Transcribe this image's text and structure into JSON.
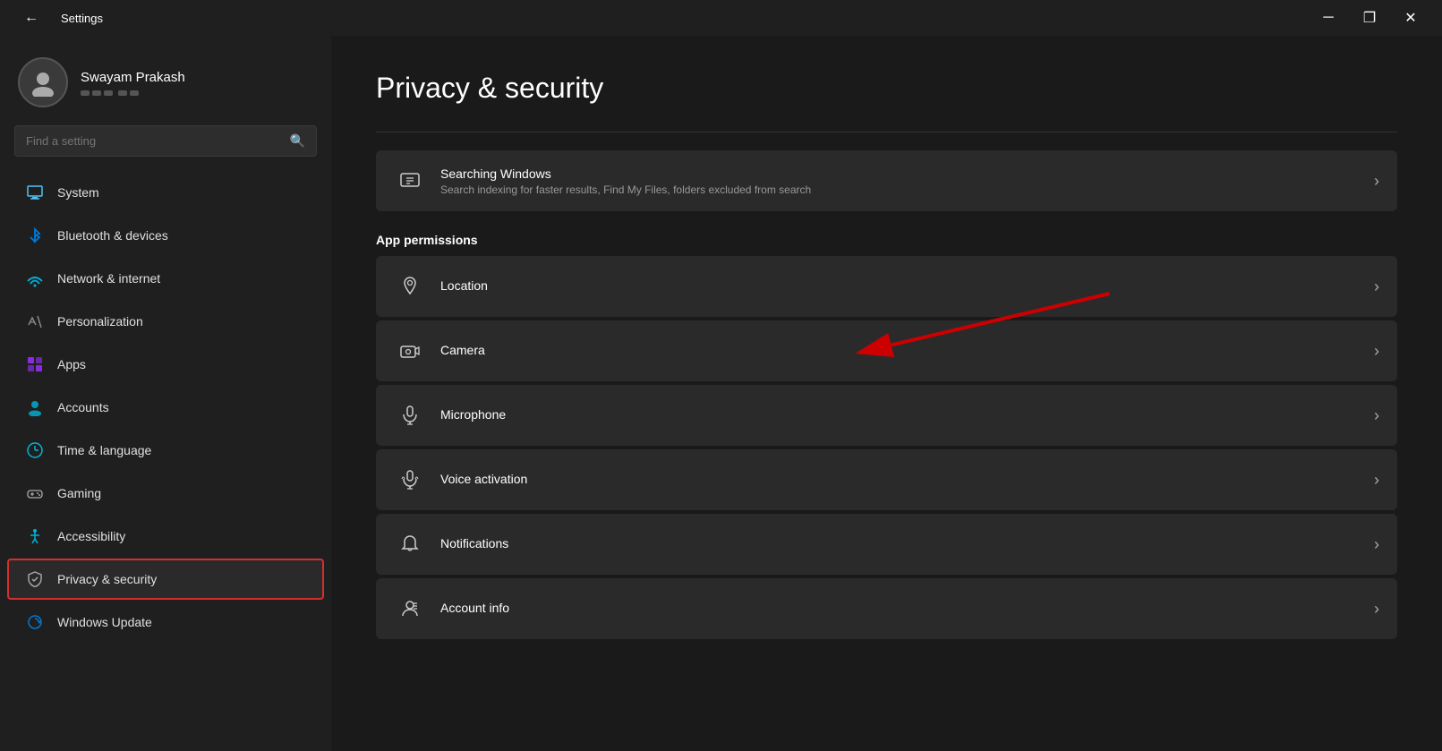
{
  "titlebar": {
    "back_icon": "←",
    "title": "Settings",
    "minimize": "─",
    "restore": "❐",
    "close": "✕"
  },
  "sidebar": {
    "user": {
      "name": "Swayam Prakash",
      "avatar_alt": "user avatar"
    },
    "search": {
      "placeholder": "Find a setting"
    },
    "nav_items": [
      {
        "id": "system",
        "label": "System",
        "icon": "🖥"
      },
      {
        "id": "bluetooth",
        "label": "Bluetooth & devices",
        "icon": "🔵"
      },
      {
        "id": "network",
        "label": "Network & internet",
        "icon": "📶"
      },
      {
        "id": "personalization",
        "label": "Personalization",
        "icon": "✏"
      },
      {
        "id": "apps",
        "label": "Apps",
        "icon": "📦"
      },
      {
        "id": "accounts",
        "label": "Accounts",
        "icon": "👤"
      },
      {
        "id": "time",
        "label": "Time & language",
        "icon": "🌐"
      },
      {
        "id": "gaming",
        "label": "Gaming",
        "icon": "🎮"
      },
      {
        "id": "accessibility",
        "label": "Accessibility",
        "icon": "♿"
      },
      {
        "id": "privacy",
        "label": "Privacy & security",
        "icon": "🛡",
        "active": true
      },
      {
        "id": "update",
        "label": "Windows Update",
        "icon": "🔄"
      }
    ]
  },
  "content": {
    "page_title": "Privacy & security",
    "searching_windows": {
      "title": "Searching Windows",
      "subtitle": "Search indexing for faster results, Find My Files, folders excluded from search"
    },
    "app_permissions_label": "App permissions",
    "permissions": [
      {
        "id": "location",
        "title": "Location",
        "icon": "location"
      },
      {
        "id": "camera",
        "title": "Camera",
        "icon": "camera"
      },
      {
        "id": "microphone",
        "title": "Microphone",
        "icon": "microphone"
      },
      {
        "id": "voice",
        "title": "Voice activation",
        "icon": "voice"
      },
      {
        "id": "notifications",
        "title": "Notifications",
        "icon": "notifications"
      },
      {
        "id": "account",
        "title": "Account info",
        "icon": "account"
      }
    ]
  }
}
